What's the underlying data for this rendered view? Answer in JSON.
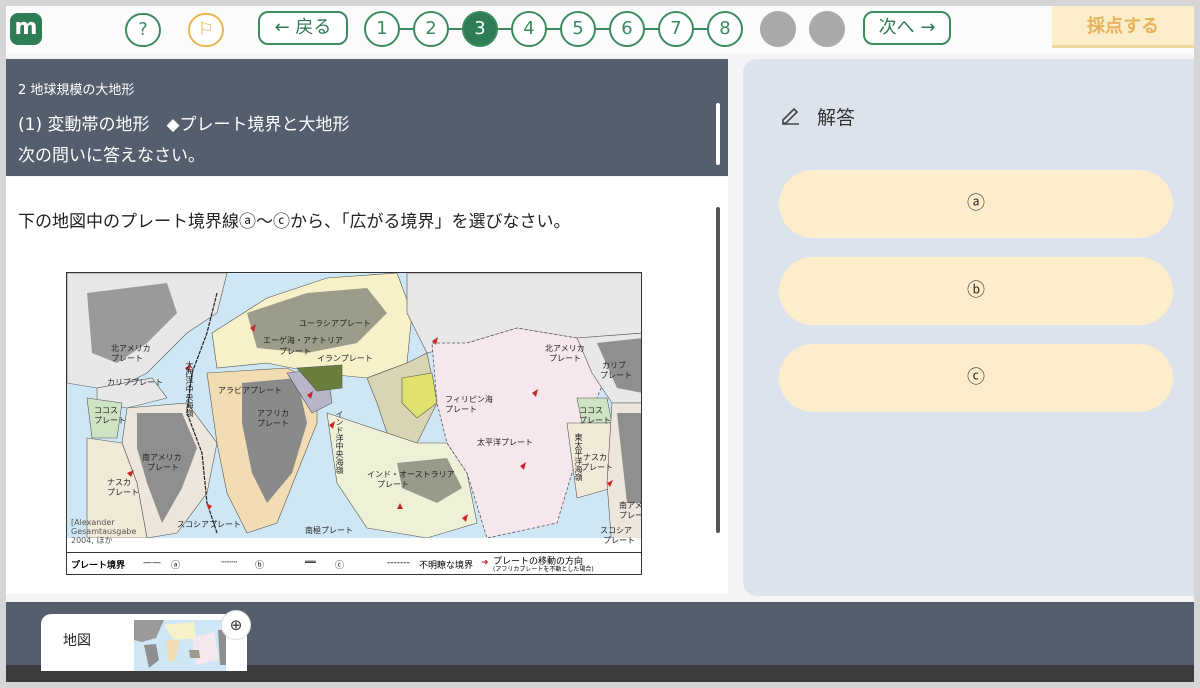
{
  "topbar": {
    "logo": "m",
    "help_label": "?",
    "flag_label": "⚐",
    "back_label": "← 戻る",
    "next_label": "次へ →",
    "score_label": "採点する",
    "steps": [
      "1",
      "2",
      "3",
      "4",
      "5",
      "6",
      "7",
      "8",
      "",
      ""
    ],
    "current_step": "3"
  },
  "question": {
    "section": "2 地球規模の大地形",
    "title": "(1) 変動帯の地形　◆プレート境界と大地形",
    "instruction": "次の問いに答えなさい。",
    "prompt": "下の地図中のプレート境界線ⓐ〜ⓒから、「広がる境界」を選びなさい。"
  },
  "map": {
    "labels": {
      "eurasia": "ユーラシアプレート",
      "aegean": "エーゲ海・アナトリア",
      "aegean2": "プレート",
      "iran": "イランプレート",
      "arabia": "アラビアプレート",
      "africa": "アフリカ",
      "africa2": "プレート",
      "na_left": "北アメリカ",
      "na_left2": "プレート",
      "carib_left": "カリブプレート",
      "cocos_left": "ココス",
      "cocos_left2": "プレート",
      "sa_left": "南アメリカ",
      "sa_left2": "プレート",
      "nazca_left": "ナスカ",
      "nazca_left2": "プレート",
      "scotia_left": "スコシアプレート",
      "antarctic": "南極プレート",
      "indo_aus": "インド・オーストラリア",
      "indo_aus2": "プレート",
      "philippine": "フィリピン海",
      "philippine2": "プレート",
      "pacific": "太平洋プレート",
      "na_right": "北アメリカ",
      "na_right2": "プレート",
      "carib_right": "カリブ",
      "carib_right2": "プレート",
      "cocos_right": "ココス",
      "cocos_right2": "プレート",
      "nazca_right": "ナスカ",
      "nazca_right2": "プレート",
      "sa_right": "南アメリカ",
      "sa_right2": "プレート",
      "scotia_right": "スコシア",
      "scotia_right2": "プレート",
      "mid_atlantic": "大西洋中央海嶺",
      "indian_ridge": "インド洋中央海嶺",
      "east_pacific": "東太平洋海嶺",
      "source": "[Alexander",
      "source2": "Gesamtausgabe",
      "source3": "2004, ほか"
    },
    "legend": {
      "title": "プレート境界",
      "a": "ⓐ",
      "b": "ⓑ",
      "c": "ⓒ",
      "unclear": "不明瞭な境界",
      "arrow": "プレートの移動の方向",
      "arrow_note": "(アフリカプレートを不動とした場合)"
    }
  },
  "answer": {
    "title": "解答",
    "choices": [
      "ⓐ",
      "ⓑ",
      "ⓒ"
    ]
  },
  "bottom": {
    "map_tab_label": "地図",
    "zoom_icon": "⊕"
  }
}
